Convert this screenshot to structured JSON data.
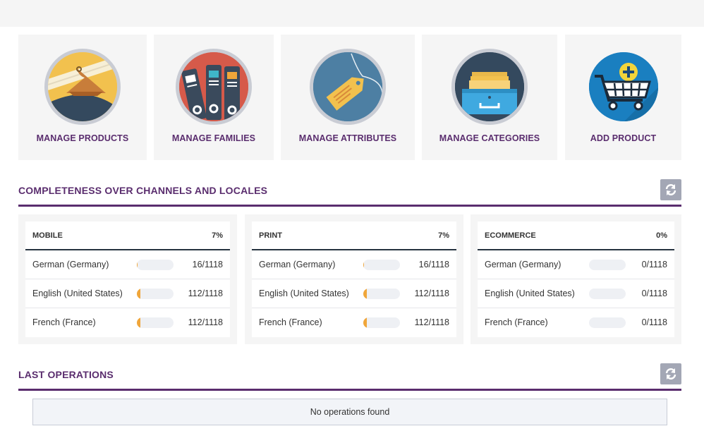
{
  "tiles": [
    {
      "label": "MANAGE PRODUCTS",
      "icon": "hanger-icon"
    },
    {
      "label": "MANAGE FAMILIES",
      "icon": "binders-icon"
    },
    {
      "label": "MANAGE ATTRIBUTES",
      "icon": "tag-icon"
    },
    {
      "label": "MANAGE CATEGORIES",
      "icon": "drawer-icon"
    },
    {
      "label": "ADD PRODUCT",
      "icon": "cart-add-icon"
    }
  ],
  "completeness": {
    "title": "COMPLETENESS OVER CHANNELS AND LOCALES",
    "refresh_icon": "refresh-icon",
    "channels": [
      {
        "name": "MOBILE",
        "percent": "7%",
        "locales": [
          {
            "name": "German (Germany)",
            "ratio": "16/1118",
            "progress": 0.014
          },
          {
            "name": "English (United States)",
            "ratio": "112/1118",
            "progress": 0.1
          },
          {
            "name": "French (France)",
            "ratio": "112/1118",
            "progress": 0.1
          }
        ]
      },
      {
        "name": "PRINT",
        "percent": "7%",
        "locales": [
          {
            "name": "German (Germany)",
            "ratio": "16/1118",
            "progress": 0.014
          },
          {
            "name": "English (United States)",
            "ratio": "112/1118",
            "progress": 0.1
          },
          {
            "name": "French (France)",
            "ratio": "112/1118",
            "progress": 0.1
          }
        ]
      },
      {
        "name": "ECOMMERCE",
        "percent": "0%",
        "locales": [
          {
            "name": "German (Germany)",
            "ratio": "0/1118",
            "progress": 0
          },
          {
            "name": "English (United States)",
            "ratio": "0/1118",
            "progress": 0
          },
          {
            "name": "French (France)",
            "ratio": "0/1118",
            "progress": 0
          }
        ]
      }
    ]
  },
  "operations": {
    "title": "LAST OPERATIONS",
    "empty_text": "No operations found"
  },
  "colors": {
    "accent": "#5a2d6e",
    "progress": "#f0a63a",
    "refresh_button": "#a3a7b5"
  }
}
